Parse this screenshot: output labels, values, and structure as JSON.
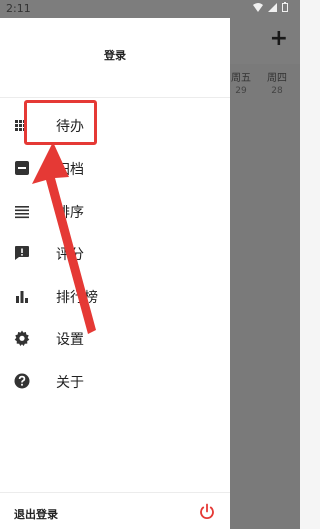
{
  "status_bar": {
    "time": "2:11",
    "icons": [
      "wifi-icon",
      "signal-icon",
      "battery-icon"
    ]
  },
  "background_app": {
    "add_button": "+",
    "days": [
      {
        "weekday": "周五",
        "date": "29"
      },
      {
        "weekday": "周四",
        "date": "28"
      }
    ]
  },
  "drawer": {
    "title": "登录",
    "menu": [
      {
        "label": "待办",
        "icon": "grid-list-icon"
      },
      {
        "label": "归档",
        "icon": "archive-minus-icon"
      },
      {
        "label": "排序",
        "icon": "lines-icon"
      },
      {
        "label": "评分",
        "icon": "feedback-icon"
      },
      {
        "label": "排行榜",
        "icon": "bar-chart-icon"
      },
      {
        "label": "设置",
        "icon": "gear-icon"
      },
      {
        "label": "关于",
        "icon": "help-icon"
      }
    ],
    "footer": {
      "logout_label": "退出登录",
      "power_icon": "power-icon"
    }
  },
  "annotation": {
    "highlight_color": "#e53935"
  },
  "colors": {
    "accent": "#e53935",
    "icon": "#333333"
  }
}
